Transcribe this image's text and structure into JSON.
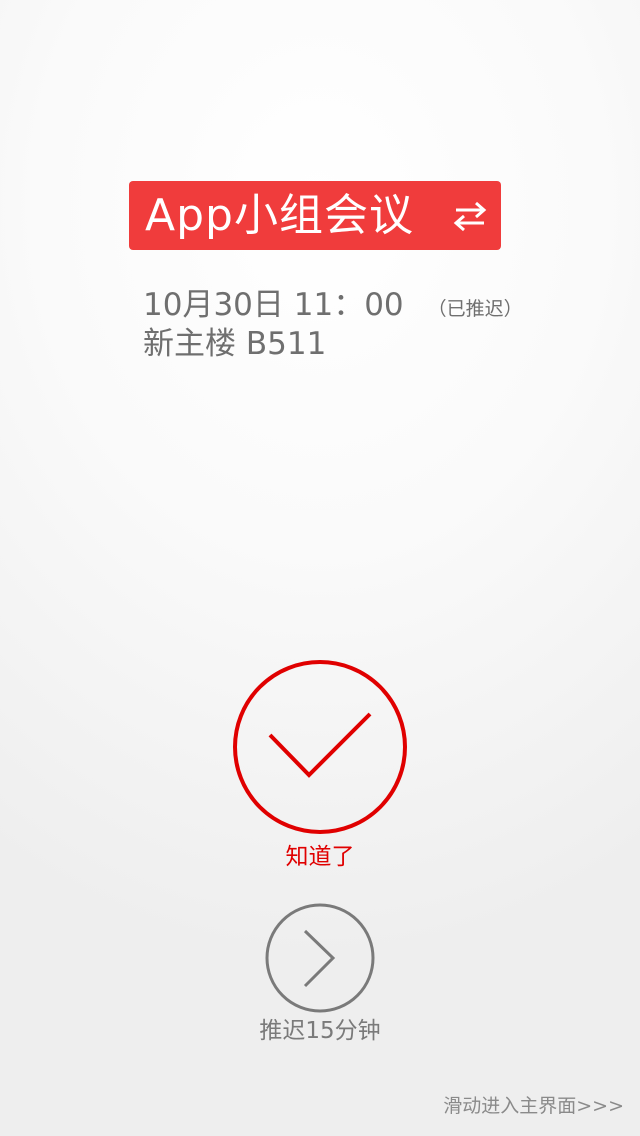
{
  "meeting": {
    "title": "App小组会议",
    "datetime": "10月30日 11：00",
    "postponed_tag": "（已推迟）",
    "location": "新主楼 B511"
  },
  "actions": {
    "acknowledge_label": "知道了",
    "snooze_label": "推迟15分钟"
  },
  "swipe_hint": "滑动进入主界面>>>",
  "icons": {
    "swap": "swap-arrows-icon",
    "check": "check-icon",
    "chevron": "chevron-right-icon"
  },
  "colors": {
    "accent_red": "#f03c3c",
    "ack_red": "#e00000",
    "snooze_gray": "#7a7a7a",
    "text_gray": "#6f6f6f"
  }
}
